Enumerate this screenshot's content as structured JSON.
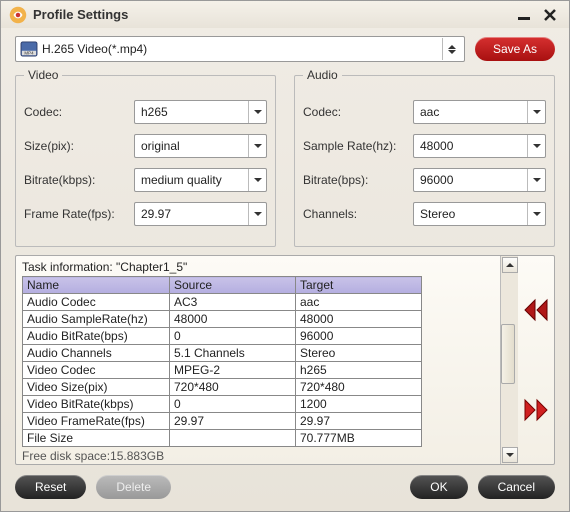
{
  "window": {
    "title": "Profile Settings"
  },
  "topbar": {
    "profile": "H.265 Video(*.mp4)",
    "saveas": "Save As"
  },
  "video": {
    "legend": "Video",
    "codec_label": "Codec:",
    "codec": "h265",
    "size_label": "Size(pix):",
    "size": "original",
    "bitrate_label": "Bitrate(kbps):",
    "bitrate": "medium quality",
    "fps_label": "Frame Rate(fps):",
    "fps": "29.97"
  },
  "audio": {
    "legend": "Audio",
    "codec_label": "Codec:",
    "codec": "aac",
    "sr_label": "Sample Rate(hz):",
    "sr": "48000",
    "bitrate_label": "Bitrate(bps):",
    "bitrate": "96000",
    "channels_label": "Channels:",
    "channels": "Stereo"
  },
  "task": {
    "title": "Task information: \"Chapter1_5\"",
    "headers": [
      "Name",
      "Source",
      "Target"
    ],
    "rows": [
      [
        "Audio Codec",
        "AC3",
        "aac"
      ],
      [
        "Audio SampleRate(hz)",
        "48000",
        "48000"
      ],
      [
        "Audio BitRate(bps)",
        "0",
        "96000"
      ],
      [
        "Audio Channels",
        "5.1 Channels",
        "Stereo"
      ],
      [
        "Video Codec",
        "MPEG-2",
        "h265"
      ],
      [
        "Video Size(pix)",
        "720*480",
        "720*480"
      ],
      [
        "Video BitRate(kbps)",
        "0",
        "1200"
      ],
      [
        "Video FrameRate(fps)",
        "29.97",
        "29.97"
      ],
      [
        "File Size",
        "",
        "70.777MB"
      ]
    ],
    "free": "Free disk space:15.883GB"
  },
  "buttons": {
    "reset": "Reset",
    "delete": "Delete",
    "ok": "OK",
    "cancel": "Cancel"
  }
}
